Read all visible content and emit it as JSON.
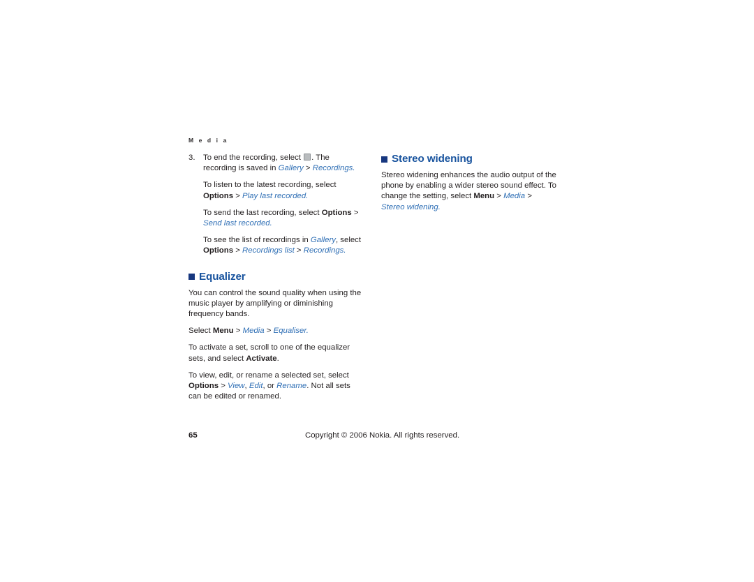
{
  "document": {
    "running_head": "M e d i a",
    "page_number": "65",
    "copyright": "Copyright © 2006 Nokia. All rights reserved."
  },
  "colors": {
    "heading_blue": "#18539e",
    "bullet_blue": "#17377f",
    "xref_blue": "#2f6fb5",
    "body_text": "#231f20",
    "page_background": "#ffffff"
  },
  "left_column": {
    "step": {
      "number": "3.",
      "text_a": "To end the recording, select",
      "icon": "stop-square-icon",
      "text_b": ". The recording is saved in",
      "xref_gallery": "Gallery",
      "sep_1": ">",
      "xref_recordings": "Recordings",
      "period": "."
    },
    "sub_paragraphs": [
      {
        "text_a": "To listen to the latest recording, select",
        "bold_options": "Options",
        "sep": ">",
        "xref": "Play last recorded",
        "period": "."
      },
      {
        "text_a": "To send the last recording, select",
        "bold_options": "Options",
        "sep": ">",
        "xref": "Send last recorded",
        "period": "."
      },
      {
        "text_a": "To see the list of recordings in",
        "xref_gallery": "Gallery",
        "text_b": ", select",
        "bold_options": "Options",
        "sep_1": ">",
        "xref_recordings_list": "Recordings list",
        "sep_2": ">",
        "xref_recordings": "Recordings",
        "period": "."
      }
    ],
    "equalizer_section": {
      "heading": "Equalizer",
      "intro": "You can control the sound quality when using the music player by amplifying or diminishing frequency bands.",
      "select_path": {
        "text_a": "Select",
        "bold_menu": "Menu",
        "sep_1": ">",
        "xref_media": "Media",
        "sep_2": ">",
        "xref_equaliser": "Equaliser",
        "period": "."
      },
      "activate": {
        "text_a": "To activate a set, scroll to one of the equalizer sets, and select",
        "bold_activate": "Activate",
        "period": "."
      },
      "view_edit_rename": {
        "text_a": "To view, edit, or rename a selected set, select",
        "bold_options": "Options",
        "sep": ">",
        "xref_view": "View",
        "comma_1": ",",
        "xref_edit": "Edit",
        "text_or": ", or",
        "xref_rename": "Rename",
        "text_b": ". Not all sets can be edited or renamed."
      }
    }
  },
  "right_column": {
    "stereo_widening_section": {
      "heading": "Stereo widening",
      "body": {
        "text_a": "Stereo widening enhances the audio output of the phone by enabling a wider stereo sound effect. To change the setting, select",
        "bold_menu": "Menu",
        "sep_1": ">",
        "xref_media": "Media",
        "sep_2": ">",
        "xref_stereo_widening": "Stereo widening",
        "period": "."
      }
    }
  }
}
